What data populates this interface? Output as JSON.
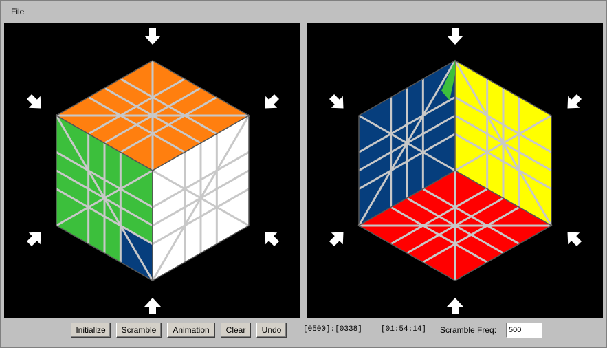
{
  "menu": {
    "file_label": "File"
  },
  "colors": {
    "orange": "#ff7f0f",
    "green": "#3cbf3c",
    "white": "#ffffff",
    "blue": "#063e7d",
    "yellow": "#ffff00",
    "red": "#ff0000",
    "grid": "#c8c8c8"
  },
  "left_cube": {
    "top_face": [
      "orange",
      "orange",
      "orange",
      "orange",
      "orange",
      "orange",
      "orange",
      "orange",
      "orange"
    ],
    "left_face": [
      "green",
      "green",
      "green",
      "green",
      "green",
      "green",
      "green",
      "green",
      "blue"
    ],
    "right_face": [
      "white",
      "white",
      "white",
      "white",
      "white",
      "white",
      "white",
      "white",
      "white"
    ]
  },
  "right_cube": {
    "upper_left_face": [
      "blue",
      "blue",
      "blue",
      "blue",
      "blue",
      "blue",
      "blue",
      "blue",
      "blue"
    ],
    "upper_right_face": [
      "yellow",
      "yellow",
      "yellow",
      "yellow",
      "yellow",
      "yellow",
      "yellow",
      "yellow",
      "yellow"
    ],
    "bottom_face": [
      "red",
      "red",
      "red",
      "red",
      "red",
      "red",
      "red",
      "red",
      "red"
    ]
  },
  "toolbar": {
    "initialize_label": "Initialize",
    "scramble_label": "Scramble",
    "animation_label": "Animation",
    "clear_label": "Clear",
    "undo_label": "Undo",
    "move_counter": "[0500]:[0338]",
    "timer": "[01:54:14]",
    "scramble_freq_label": "Scramble Freq:",
    "scramble_freq_value": "500"
  }
}
